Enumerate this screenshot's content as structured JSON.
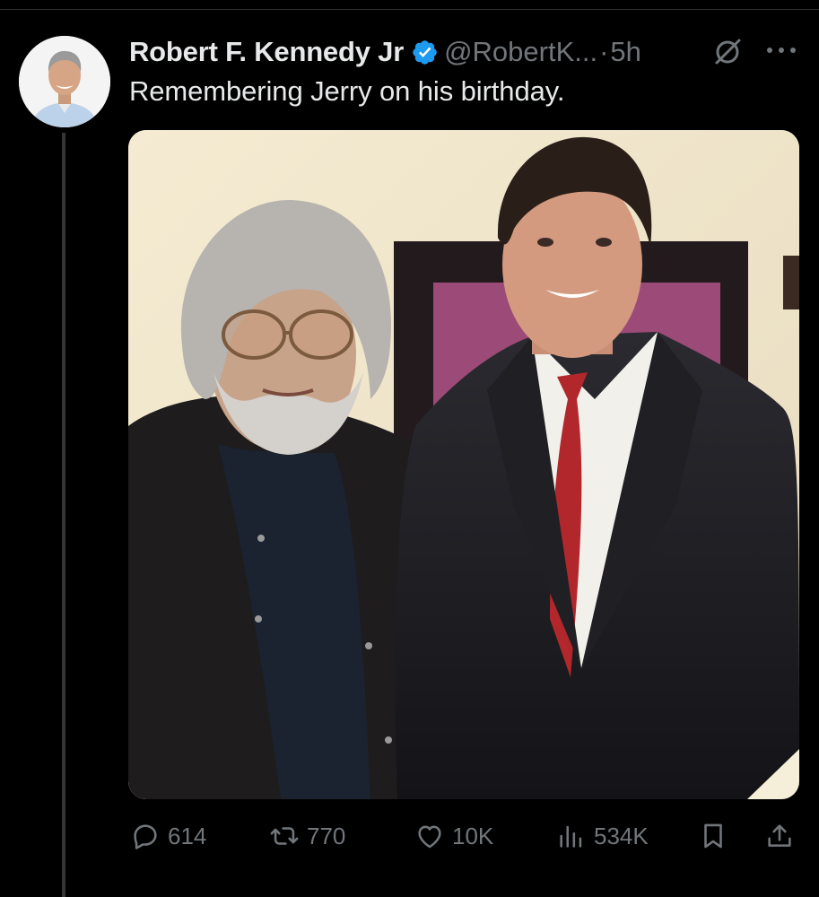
{
  "post": {
    "author": {
      "display_name": "Robert F. Kennedy Jr",
      "handle": "@RobertK...",
      "verified": true,
      "avatar_icon": "profile-photo"
    },
    "separator": "·",
    "timestamp": "5h",
    "text": "Remembering Jerry on his birthday.",
    "media": {
      "type": "photo"
    },
    "actions": {
      "replies": "614",
      "reposts": "770",
      "likes": "10K",
      "views": "534K"
    }
  },
  "colors": {
    "background": "#000000",
    "text_primary": "#e7e9ea",
    "text_secondary": "#71767b",
    "verified": "#1d9bf0",
    "divider": "#2f3336"
  },
  "icons": {
    "reply": "speech-bubble-icon",
    "repost": "repost-arrows-icon",
    "like": "heart-icon",
    "views": "bar-chart-icon",
    "bookmark": "bookmark-icon",
    "share": "share-upload-icon",
    "grok": "grok-slash-icon",
    "more": "ellipsis-icon"
  }
}
